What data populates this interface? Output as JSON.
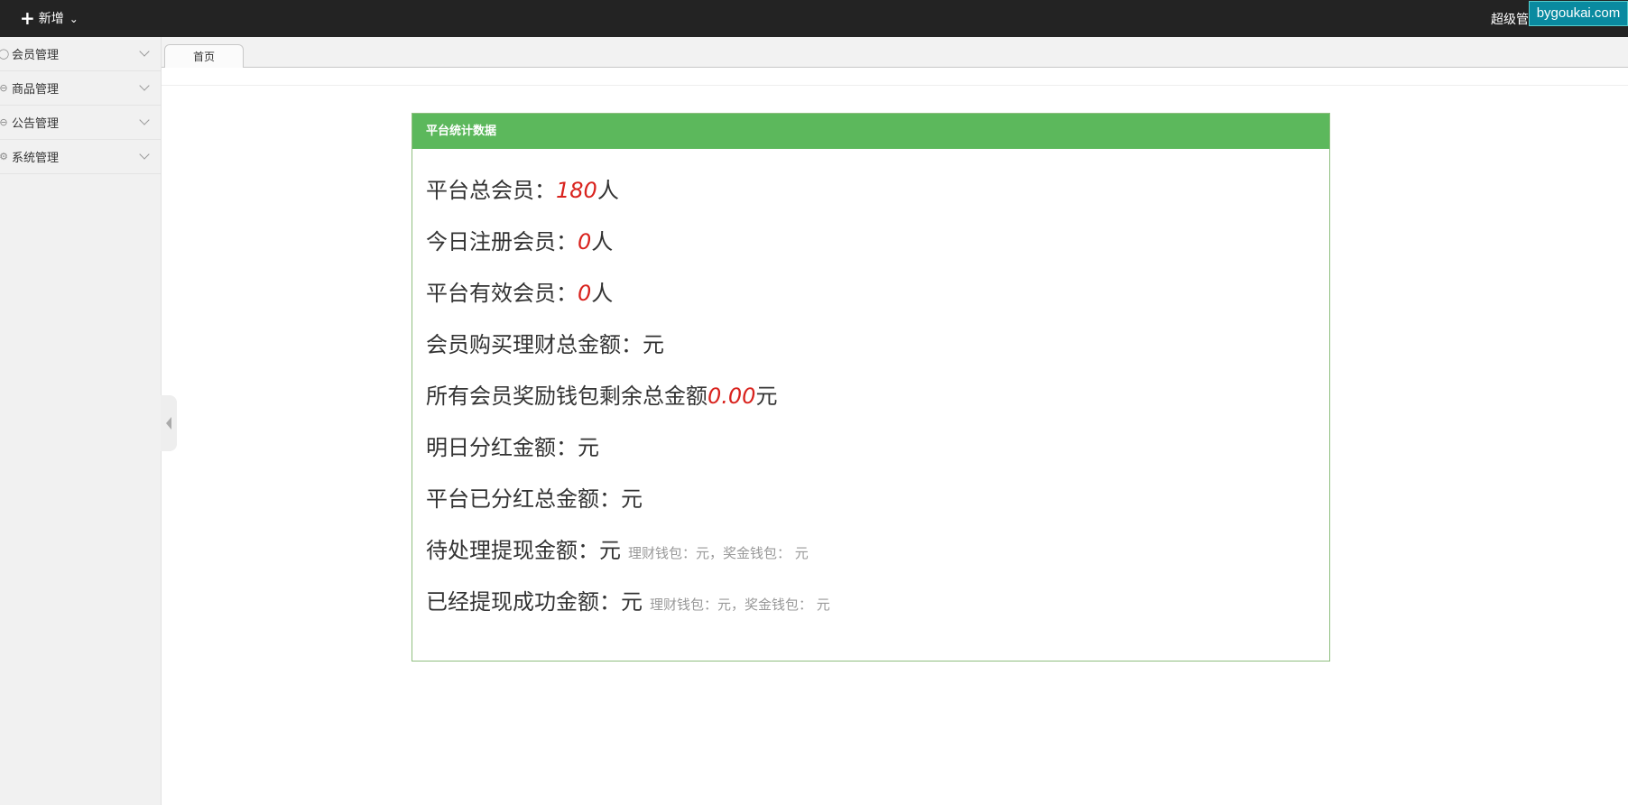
{
  "topbar": {
    "new_label": "新增",
    "user_name": "超级管",
    "watermark": "bygoukai.com"
  },
  "sidebar": {
    "items": [
      {
        "label": "会员管理",
        "icon": "user-icon"
      },
      {
        "label": "商品管理",
        "icon": "circle-icon"
      },
      {
        "label": "公告管理",
        "icon": "circle-icon"
      },
      {
        "label": "系统管理",
        "icon": "gear-icon"
      }
    ]
  },
  "tabs": [
    {
      "label": "首页"
    }
  ],
  "panel": {
    "title": "平台统计数据",
    "stats": [
      {
        "label": "平台总会员：",
        "value": "180",
        "unit": "人"
      },
      {
        "label": "今日注册会员：",
        "value": "0",
        "unit": "人"
      },
      {
        "label": "平台有效会员：",
        "value": "0",
        "unit": "人"
      },
      {
        "label": "会员购买理财总金额：",
        "value": "",
        "unit": "元"
      },
      {
        "label": "所有会员奖励钱包剩余总金额",
        "value": "0.00",
        "unit": "元"
      },
      {
        "label": "明日分红金额：",
        "value": "",
        "unit": "元"
      },
      {
        "label": "平台已分红总金额：",
        "value": "",
        "unit": "元"
      },
      {
        "label": "待处理提现金额：",
        "value": "",
        "unit": "元",
        "detail": "理财钱包：元，奖金钱包： 元"
      },
      {
        "label": "已经提现成功金额：",
        "value": "",
        "unit": "元",
        "detail": "理财钱包：元，奖金钱包： 元"
      }
    ]
  }
}
